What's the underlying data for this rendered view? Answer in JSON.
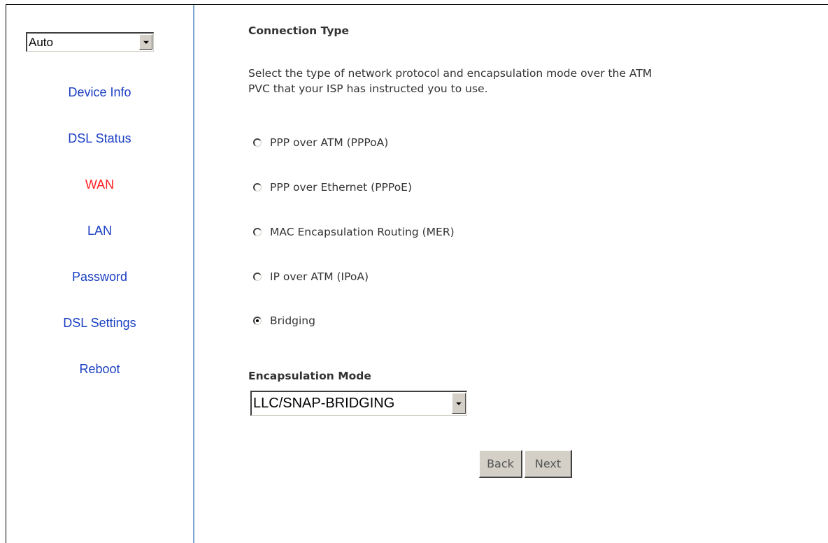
{
  "sidebar": {
    "language_select": {
      "value": "Auto"
    },
    "items": [
      {
        "label": "Device Info"
      },
      {
        "label": "DSL Status"
      },
      {
        "label": "WAN"
      },
      {
        "label": "LAN"
      },
      {
        "label": "Password"
      },
      {
        "label": "DSL Settings"
      },
      {
        "label": "Reboot"
      }
    ],
    "active_item": "WAN",
    "link_color": "#1a3fc2",
    "active_color": "#ff2020"
  },
  "main": {
    "connection_type": {
      "heading": "Connection Type",
      "description_line1": "Select the type of network protocol and encapsulation mode over the ATM",
      "description_line2": "PVC that your ISP has instructed you to use.",
      "options": [
        {
          "label": "PPP over ATM (PPPoA)",
          "selected": false
        },
        {
          "label": "PPP over Ethernet (PPPoE)",
          "selected": false
        },
        {
          "label": "MAC Encapsulation Routing (MER)",
          "selected": false
        },
        {
          "label": "IP over ATM (IPoA)",
          "selected": false
        },
        {
          "label": "Bridging",
          "selected": true
        }
      ]
    },
    "encapsulation": {
      "heading": "Encapsulation Mode",
      "value": "LLC/SNAP-BRIDGING"
    },
    "buttons": {
      "back": "Back",
      "next": "Next"
    }
  }
}
